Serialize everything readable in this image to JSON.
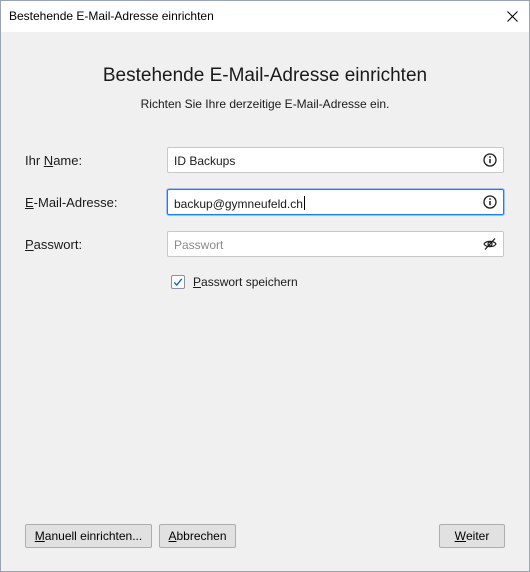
{
  "window": {
    "title": "Bestehende E-Mail-Adresse einrichten"
  },
  "header": {
    "heading": "Bestehende E-Mail-Adresse einrichten",
    "subheading": "Richten Sie Ihre derzeitige E-Mail-Adresse ein."
  },
  "form": {
    "name": {
      "label_pre": "Ihr ",
      "label_key": "N",
      "label_post": "ame:",
      "value": "ID Backups",
      "icon": "info-icon"
    },
    "email": {
      "label_pre": "",
      "label_key": "E",
      "label_post": "-Mail-Adresse:",
      "value": "backup@gymneufeld.ch",
      "icon": "info-icon"
    },
    "password": {
      "label_pre": "",
      "label_key": "P",
      "label_post": "asswort:",
      "value": "",
      "placeholder": "Passwort",
      "icon": "eye-slash-icon"
    },
    "remember": {
      "checked": true,
      "label_key": "P",
      "label_post": "asswort speichern"
    }
  },
  "buttons": {
    "manual": {
      "label_key": "M",
      "label_post": "anuell einrichten..."
    },
    "cancel": {
      "label_key": "A",
      "label_post": "bbrechen"
    },
    "next": {
      "label_key": "W",
      "label_post": "eiter"
    }
  },
  "colors": {
    "focus": "#0a84ff",
    "checkmark": "#0060df"
  }
}
